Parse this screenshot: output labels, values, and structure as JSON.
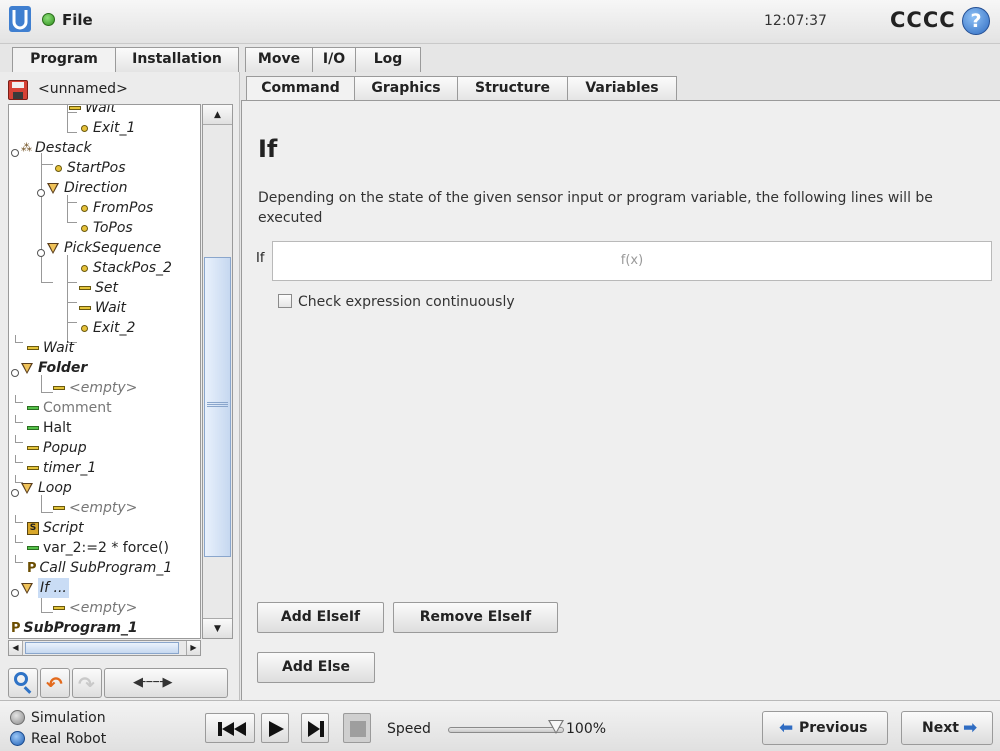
{
  "topbar": {
    "file_label": "File",
    "clock": "12:07:37",
    "robot_name": "CCCC",
    "help_symbol": "?"
  },
  "main_tabs": [
    {
      "label": "Program",
      "active": true
    },
    {
      "label": "Installation",
      "active": false
    },
    {
      "label": "Move",
      "active": false
    },
    {
      "label": "I/O",
      "active": false
    },
    {
      "label": "Log",
      "active": false
    }
  ],
  "program": {
    "name": "<unnamed>"
  },
  "tree": [
    {
      "label": "Wait",
      "icon": "bar-icon"
    },
    {
      "label": "Exit_1",
      "icon": "dot-icon"
    },
    {
      "label": "Destack",
      "icon": "pattern-icon"
    },
    {
      "label": "StartPos",
      "icon": "dot-icon"
    },
    {
      "label": "Direction",
      "icon": "triangle-icon"
    },
    {
      "label": "FromPos",
      "icon": "dot-icon"
    },
    {
      "label": "ToPos",
      "icon": "dot-icon"
    },
    {
      "label": "PickSequence",
      "icon": "triangle-icon"
    },
    {
      "label": "StackPos_2",
      "icon": "dot-icon"
    },
    {
      "label": "Set",
      "icon": "bar-icon"
    },
    {
      "label": "Wait",
      "icon": "bar-icon"
    },
    {
      "label": "Exit_2",
      "icon": "dot-icon"
    },
    {
      "label": "Wait",
      "icon": "bar-icon"
    },
    {
      "label": "Folder",
      "icon": "triangle-icon"
    },
    {
      "label": "<empty>",
      "icon": "bar-icon"
    },
    {
      "label": "Comment",
      "icon": "bar-icon"
    },
    {
      "label": "Halt",
      "icon": "bar-icon"
    },
    {
      "label": "Popup",
      "icon": "bar-icon"
    },
    {
      "label": "timer_1",
      "icon": "bar-icon"
    },
    {
      "label": "Loop",
      "icon": "triangle-icon"
    },
    {
      "label": "<empty>",
      "icon": "bar-icon"
    },
    {
      "label": "Script",
      "icon": "script-icon"
    },
    {
      "label": "var_2:=2 * force()",
      "icon": "bar-icon"
    },
    {
      "label": "Call SubProgram_1",
      "icon": "call-icon"
    },
    {
      "label": "If ...",
      "icon": "triangle-icon"
    },
    {
      "label": "<empty>",
      "icon": "bar-icon"
    },
    {
      "label": "SubProgram_1",
      "icon": "call-icon"
    }
  ],
  "sub_tabs": [
    {
      "label": "Command",
      "active": true
    },
    {
      "label": "Graphics",
      "active": false
    },
    {
      "label": "Structure",
      "active": false
    },
    {
      "label": "Variables",
      "active": false
    }
  ],
  "command": {
    "title": "If",
    "description": "Depending on the state of the given sensor input or program variable, the following lines will be executed",
    "if_label": "If",
    "expression_placeholder": "f(x)",
    "check_label": "Check expression continuously",
    "check_checked": false,
    "add_elseif": "Add ElseIf",
    "remove_elseif": "Remove ElseIf",
    "add_else": "Add Else"
  },
  "bottombar": {
    "simulation_label": "Simulation",
    "real_robot_label": "Real Robot",
    "selected_mode": "Real Robot",
    "speed_label": "Speed",
    "speed_value": "100%",
    "speed_fraction": 1.0,
    "previous_label": "Previous",
    "next_label": "Next"
  },
  "colors": {
    "accent": "#2f6cc2",
    "running": "#3a9a28",
    "tree_highlight": "#c9dcf5"
  }
}
